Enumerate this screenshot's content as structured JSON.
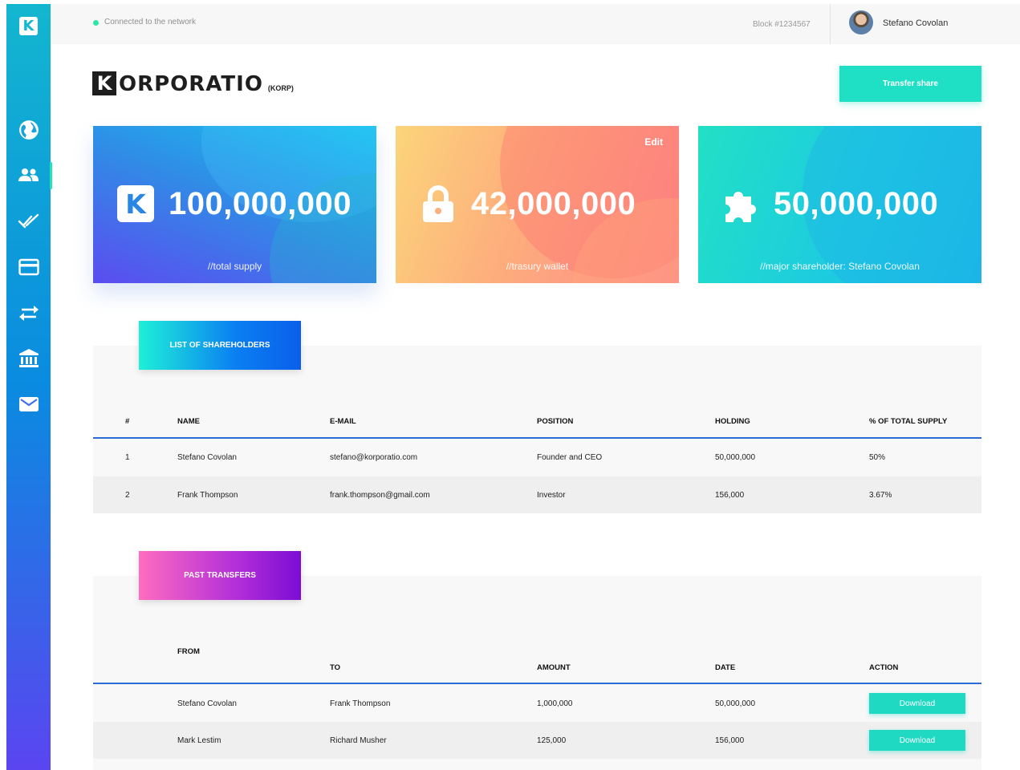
{
  "app": {
    "logo_letter": "K"
  },
  "topbar": {
    "status": "Connected to the network",
    "block": "Block #1234567",
    "user_name": "Stefano Covolan"
  },
  "brand": {
    "letter": "K",
    "name": "ORPORATIO",
    "ticker": "(KORP)"
  },
  "actions": {
    "transfer_share": "Transfer share"
  },
  "sidebar": {
    "items": [
      {
        "icon": "globe-icon"
      },
      {
        "icon": "users-icon"
      },
      {
        "icon": "double-check-icon"
      },
      {
        "icon": "credit-card-icon"
      },
      {
        "icon": "transfer-arrows-icon"
      },
      {
        "icon": "bank-icon"
      },
      {
        "icon": "mail-icon"
      }
    ],
    "active_index": 1
  },
  "cards": [
    {
      "icon": "k-logo-icon",
      "value": "100,000,000",
      "label": "//total supply"
    },
    {
      "icon": "lock-icon",
      "value": "42,000,000",
      "label": "//trasury wallet",
      "edit": "Edit"
    },
    {
      "icon": "puzzle-icon",
      "value": "50,000,000",
      "label": "//major shareholder: Stefano Covolan"
    }
  ],
  "shareholders": {
    "tab": "LIST OF SHAREHOLDERS",
    "headers": [
      "#",
      "NAME",
      "E-MAIL",
      "POSITION",
      "HOLDING",
      "% OF TOTAL SUPPLY"
    ],
    "rows": [
      [
        "1",
        "Stefano Covolan",
        "stefano@korporatio.com",
        "Founder and CEO",
        "50,000,000",
        "50%"
      ],
      [
        "2",
        "Frank Thompson",
        "frank.thompson@gmail.com",
        "Investor",
        "156,000",
        "3.67%"
      ]
    ]
  },
  "transfers": {
    "tab": "PAST TRANSFERS",
    "headers": [
      "FROM",
      "TO",
      "AMOUNT",
      "DATE",
      "ACTION"
    ],
    "rows": [
      [
        "Stefano Covolan",
        "Frank Thompson",
        "1,000,000",
        "50,000,000",
        "Download"
      ],
      [
        "Mark Lestim",
        "Richard Musher",
        "125,000",
        "156,000",
        "Download"
      ]
    ]
  },
  "colors": {
    "accent": "#1fe0c4",
    "rule": "#2a6bd6"
  }
}
